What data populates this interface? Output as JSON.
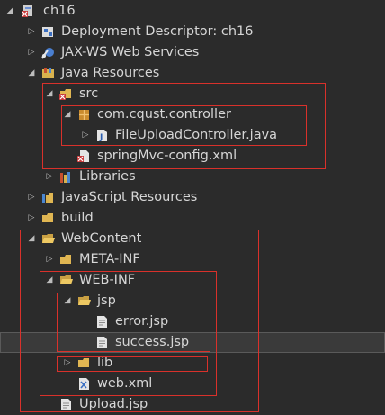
{
  "tree": {
    "project": "ch16",
    "deployment_descriptor": "Deployment Descriptor: ch16",
    "jaxws": "JAX-WS Web Services",
    "java_resources": "Java Resources",
    "src": "src",
    "package": "com.cqust.controller",
    "controller_file": "FileUploadController.java",
    "spring_config": "springMvc-config.xml",
    "libraries": "Libraries",
    "js_resources": "JavaScript Resources",
    "build": "build",
    "webcontent": "WebContent",
    "metainf": "META-INF",
    "webinf": "WEB-INF",
    "jsp": "jsp",
    "error_jsp": "error.jsp",
    "success_jsp": "success.jsp",
    "lib": "lib",
    "web_xml": "web.xml",
    "upload_jsp": "Upload.jsp"
  },
  "colors": {
    "background": "#2b2b2b",
    "text": "#d6d6d6",
    "highlight_box": "#d9312b",
    "folder": "#e0b652",
    "selection": "#3a3a3a"
  }
}
